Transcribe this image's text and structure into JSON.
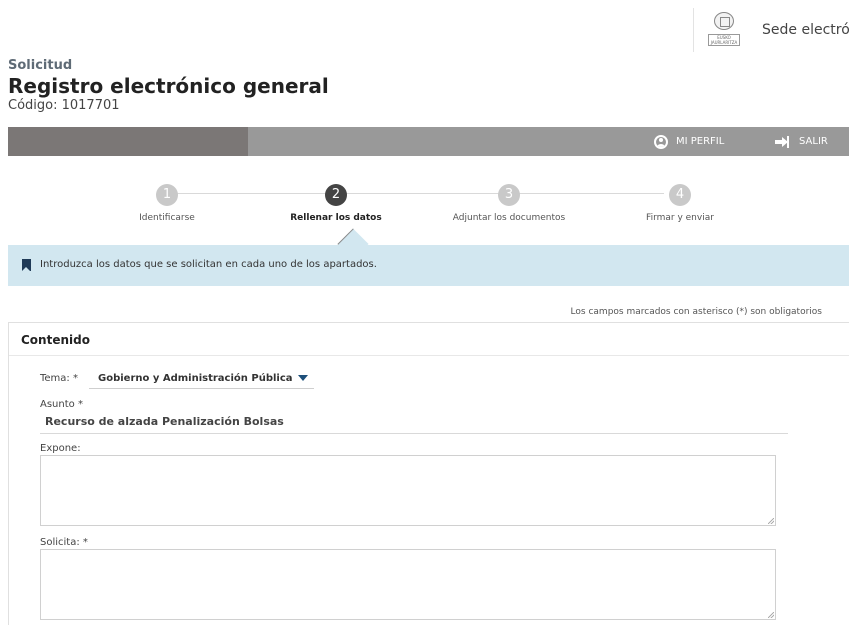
{
  "header": {
    "logo_text": "EUSKO JAURLARITZA GOBIERNO VASCO",
    "sede_label": "Sede electrónic"
  },
  "title": {
    "pre_title": "Solicitud",
    "main_title": "Registro electrónico general",
    "code_line": "Código: 1017701"
  },
  "toolbar": {
    "profile_label": "MI PERFIL",
    "exit_label": "SALIR"
  },
  "stepper": {
    "steps": [
      {
        "number": "1",
        "label": "Identificarse",
        "active": false
      },
      {
        "number": "2",
        "label": "Rellenar los datos",
        "active": true
      },
      {
        "number": "3",
        "label": "Adjuntar los documentos",
        "active": false
      },
      {
        "number": "4",
        "label": "Firmar y enviar",
        "active": false
      }
    ]
  },
  "info": {
    "text": "Introduzca los datos que se solicitan en cada uno de los apartados."
  },
  "required_note": "Los campos marcados con asterisco (*) son obligatorios",
  "form": {
    "section_title": "Contenido",
    "tema_label": "Tema:  *",
    "tema_value": "Gobierno y Administración Pública",
    "asunto_label": "Asunto  *",
    "asunto_value": "Recurso de alzada Penalización Bolsas",
    "expone_label": "Expone:",
    "expone_value": "",
    "solicita_label": "Solicita:  *",
    "solicita_value": ""
  },
  "colors": {
    "toolbar_grey": "#999999",
    "toolbar_dark": "#7b7776",
    "info_bg": "#d2e7f0",
    "accent_navy": "#1f3a57",
    "active_step": "#444444",
    "inactive_step": "#c9c9c9"
  }
}
